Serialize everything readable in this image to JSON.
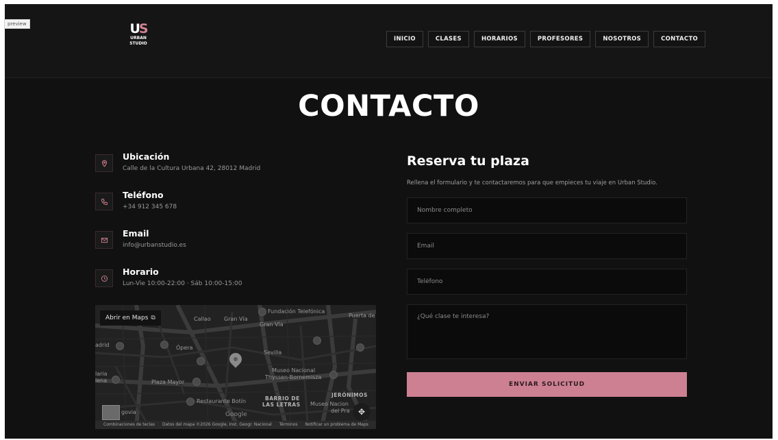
{
  "preview_tag": "preview",
  "brand": {
    "mark_u": "U",
    "mark_s": "S",
    "line1": "URBAN",
    "line2": "STUDIO"
  },
  "nav": {
    "items": [
      {
        "label": "INICIO"
      },
      {
        "label": "CLASES"
      },
      {
        "label": "HORARIOS"
      },
      {
        "label": "PROFESORES"
      },
      {
        "label": "NOSOTROS"
      },
      {
        "label": "CONTACTO"
      }
    ]
  },
  "page": {
    "title": "CONTACTO"
  },
  "contact": {
    "items": [
      {
        "label": "Ubicación",
        "value": "Calle de la Cultura Urbana 42, 28012 Madrid",
        "icon": "location-pin-icon"
      },
      {
        "label": "Teléfono",
        "value": "+34 912 345 678",
        "icon": "phone-icon"
      },
      {
        "label": "Email",
        "value": "info@urbanstudio.es",
        "icon": "mail-icon"
      },
      {
        "label": "Horario",
        "value": "Lun-Vie 10:00-22:00 · Sáb 10:00-15:00",
        "icon": "clock-icon"
      }
    ]
  },
  "map": {
    "open_button": "Abrir en Maps",
    "labels": [
      "Fundación Telefónica",
      "Callao",
      "Gran Vía",
      "Gran Vía",
      "Puerta de",
      "adrid",
      "Ópera",
      "Sevilla",
      "Museo Nacional",
      "Thyssen-Bornemisza",
      "laria",
      "lena",
      "Plaza Mayor",
      "Restaurante Botín",
      "BARRIO DE",
      "LAS LETRAS",
      "JERÓNIMOS",
      "Museo Nacion",
      "del Pra",
      "govia"
    ],
    "google": "Google",
    "footer": [
      "Combinaciones de teclas",
      "Datos del mapa ©2026 Google, Inst. Geogr. Nacional",
      "Términos",
      "Notificar un problema de Maps"
    ]
  },
  "form": {
    "title": "Reserva tu plaza",
    "subtitle": "Rellena el formulario y te contactaremos para que empieces tu viaje en Urban Studio.",
    "name_placeholder": "Nombre completo",
    "email_placeholder": "Email",
    "phone_placeholder": "Teléfono",
    "message_placeholder": "¿Qué clase te interesa?",
    "submit_label": "ENVIAR SOLICITUD"
  },
  "colors": {
    "accent": "#cd8092",
    "background": "#111111",
    "header": "#151515"
  }
}
